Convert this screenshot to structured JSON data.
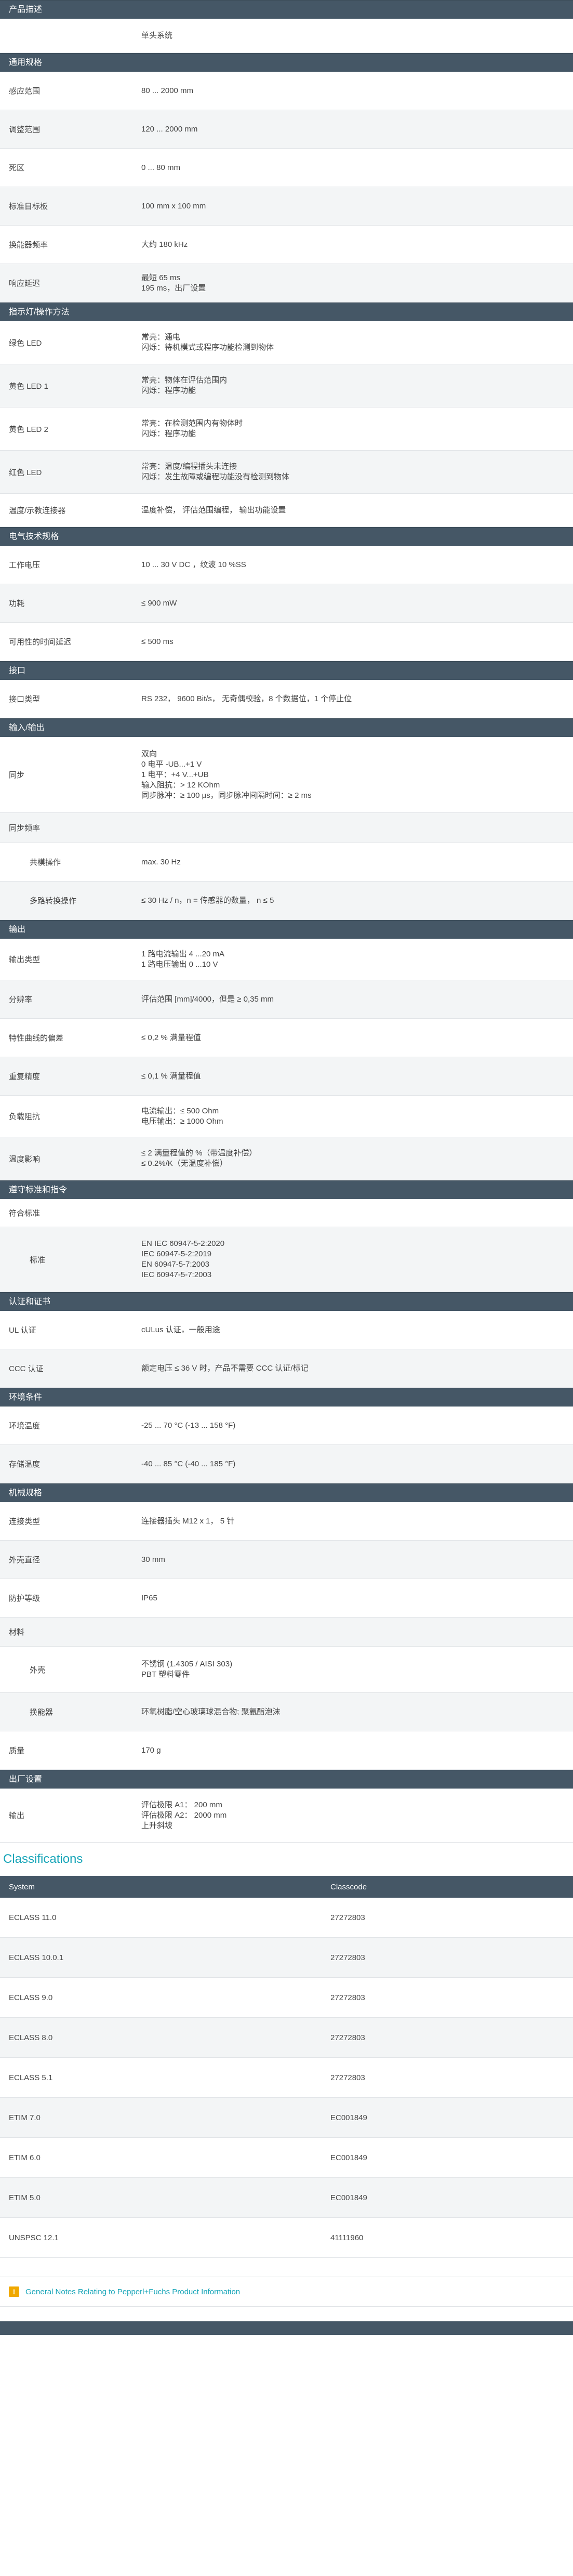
{
  "sections": [
    {
      "title": "产品描述",
      "rows": [
        {
          "label": "",
          "value": "单头系统",
          "h": 66
        }
      ]
    },
    {
      "title": "通用规格",
      "rows": [
        {
          "label": "感应范围",
          "value": "80 ... 2000 mm",
          "h": 74
        },
        {
          "label": "调整范围",
          "value": "120 ... 2000 mm",
          "h": 74
        },
        {
          "label": "死区",
          "value": "0 ... 80 mm",
          "h": 74
        },
        {
          "label": "标准目标板",
          "value": "100 mm x 100 mm",
          "h": 74
        },
        {
          "label": "换能器频率",
          "value": "大约 180 kHz",
          "h": 74
        },
        {
          "label": "响应延迟",
          "value": "最短 65 ms\n195 ms，出厂设置",
          "h": 74
        }
      ]
    },
    {
      "title": "指示灯/操作方法",
      "rows": [
        {
          "label": "绿色 LED",
          "value": "常亮：通电\n闪烁：待机模式或程序功能检测到物体",
          "h": 83
        },
        {
          "label": "黄色 LED 1",
          "value": "常亮：物体在评估范围内\n闪烁：程序功能",
          "h": 83
        },
        {
          "label": "黄色 LED 2",
          "value": "常亮：在检测范围内有物体时\n闪烁：程序功能",
          "h": 83
        },
        {
          "label": "红色 LED",
          "value": "常亮：温度/编程插头未连接\n闪烁：发生故障或编程功能没有检测到物体",
          "h": 83
        },
        {
          "label": "温度/示教连接器",
          "value": "温度补偿， 评估范围编程， 输出功能设置",
          "h": 64
        }
      ]
    },
    {
      "title": "电气技术规格",
      "rows": [
        {
          "label": "工作电压",
          "value": "10 ... 30 V DC ，纹波 10 %SS",
          "h": 74
        },
        {
          "label": "功耗",
          "value": "≤ 900 mW",
          "h": 74
        },
        {
          "label": "可用性的时间延迟",
          "value": "≤ 500 ms",
          "h": 74
        }
      ]
    },
    {
      "title": "接口",
      "rows": [
        {
          "label": "接口类型",
          "value": "RS 232， 9600 Bit/s， 无奇偶校验，8 个数据位，1 个停止位",
          "h": 74
        }
      ]
    },
    {
      "title": "输入/输出",
      "rows": [
        {
          "label": "同步",
          "value": "双向\n0 电平 -UB...+1 V\n1 电平：+4 V...+UB\n输入阻抗：> 12 KOhm\n同步脉冲：≥ 100 µs，同步脉冲间隔时间：≥ 2 ms",
          "h": 146
        },
        {
          "label": "同步频率",
          "value": "",
          "h": 58
        },
        {
          "label": "共模操作",
          "value": "max. 30 Hz",
          "h": 74,
          "sub": true
        },
        {
          "label": "多路转换操作",
          "value": "≤ 30 Hz / n，n = 传感器的数量， n ≤ 5",
          "h": 74,
          "sub": true
        }
      ]
    },
    {
      "title": "输出",
      "rows": [
        {
          "label": "输出类型",
          "value": "1 路电流输出 4 ...20 mA\n1 路电压输出 0 ...10 V",
          "h": 80
        },
        {
          "label": "分辨率",
          "value": "评估范围 [mm]/4000，但是 ≥ 0,35 mm",
          "h": 74
        },
        {
          "label": "特性曲线的偏差",
          "value": "≤ 0,2 % 满量程值",
          "h": 74
        },
        {
          "label": "重复精度",
          "value": "≤ 0,1 % 满量程值",
          "h": 74
        },
        {
          "label": "负载阻抗",
          "value": "电流输出：≤ 500 Ohm\n电压输出：≥ 1000 Ohm",
          "h": 80
        },
        {
          "label": "温度影响",
          "value": "≤ 2 满量程值的 %（带温度补偿）\n≤ 0.2%/K（无温度补偿）",
          "h": 83
        }
      ]
    },
    {
      "title": "遵守标准和指令",
      "rows": [
        {
          "label": "符合标准",
          "value": "",
          "h": 54
        },
        {
          "label": "标准",
          "value": "EN IEC 60947-5-2:2020\nIEC 60947-5-2:2019\nEN 60947-5-7:2003\nIEC 60947-5-7:2003",
          "h": 125,
          "sub": true
        }
      ]
    },
    {
      "title": "认证和证书",
      "rows": [
        {
          "label": "UL 认证",
          "value": "cULus 认证，一般用途",
          "h": 74
        },
        {
          "label": "CCC 认证",
          "value": "额定电压 ≤ 36 V 时，产品不需要 CCC 认证/标记",
          "h": 74
        }
      ]
    },
    {
      "title": "环境条件",
      "rows": [
        {
          "label": "环境温度",
          "value": "-25 ... 70 °C (-13 ... 158 °F)",
          "h": 74
        },
        {
          "label": "存储温度",
          "value": "-40 ... 85 °C (-40 ... 185 °F)",
          "h": 74
        }
      ]
    },
    {
      "title": "机械规格",
      "rows": [
        {
          "label": "连接类型",
          "value": "连接器插头 M12 x 1， 5 针",
          "h": 74
        },
        {
          "label": "外壳直径",
          "value": "30 mm",
          "h": 74
        },
        {
          "label": "防护等级",
          "value": "IP65",
          "h": 74
        },
        {
          "label": "材料",
          "value": "",
          "h": 56
        },
        {
          "label": "外壳",
          "value": "不锈钢 (1.4305 / AISI 303)\nPBT 塑料零件",
          "h": 89,
          "sub": true
        },
        {
          "label": "换能器",
          "value": "环氧树脂/空心玻璃球混合物; 聚氨酯泡沫",
          "h": 74,
          "sub": true
        },
        {
          "label": "质量",
          "value": "170 g",
          "h": 74
        }
      ]
    },
    {
      "title": "出厂设置",
      "rows": [
        {
          "label": "输出",
          "value": "评估极限 A1： 200 mm\n评估极限 A2： 2000 mm\n上升斜坡",
          "h": 104
        }
      ]
    }
  ],
  "classifications": {
    "title": "Classifications",
    "col_system": "System",
    "col_classcode": "Classcode",
    "rows": [
      {
        "system": "ECLASS 11.0",
        "code": "27272803"
      },
      {
        "system": "ECLASS 10.0.1",
        "code": "27272803"
      },
      {
        "system": "ECLASS 9.0",
        "code": "27272803"
      },
      {
        "system": "ECLASS 8.0",
        "code": "27272803"
      },
      {
        "system": "ECLASS 5.1",
        "code": "27272803"
      },
      {
        "system": "ETIM 7.0",
        "code": "EC001849"
      },
      {
        "system": "ETIM 6.0",
        "code": "EC001849"
      },
      {
        "system": "ETIM 5.0",
        "code": "EC001849"
      },
      {
        "system": "UNSPSC 12.1",
        "code": "41111960"
      }
    ]
  },
  "notes": {
    "icon": "!",
    "link": "General Notes Relating to Pepperl+Fuchs Product Information"
  }
}
